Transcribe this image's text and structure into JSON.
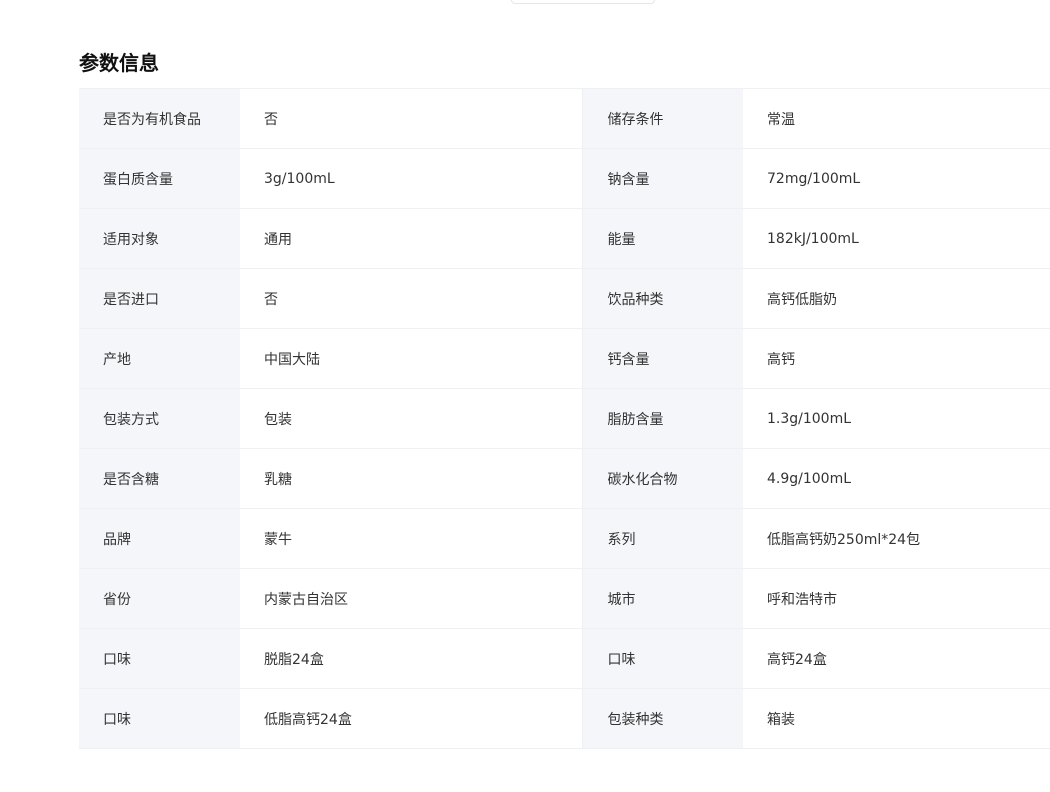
{
  "section": {
    "title": "参数信息"
  },
  "params": [
    {
      "left_label": "是否为有机食品",
      "left_value": "否",
      "right_label": "储存条件",
      "right_value": "常温"
    },
    {
      "left_label": "蛋白质含量",
      "left_value": "3g/100mL",
      "right_label": "钠含量",
      "right_value": "72mg/100mL"
    },
    {
      "left_label": "适用对象",
      "left_value": "通用",
      "right_label": "能量",
      "right_value": "182kJ/100mL"
    },
    {
      "left_label": "是否进口",
      "left_value": "否",
      "right_label": "饮品种类",
      "right_value": "高钙低脂奶"
    },
    {
      "left_label": "产地",
      "left_value": "中国大陆",
      "right_label": "钙含量",
      "right_value": "高钙"
    },
    {
      "left_label": "包装方式",
      "left_value": "包装",
      "right_label": "脂肪含量",
      "right_value": "1.3g/100mL"
    },
    {
      "left_label": "是否含糖",
      "left_value": "乳糖",
      "right_label": "碳水化合物",
      "right_value": "4.9g/100mL"
    },
    {
      "left_label": "品牌",
      "left_value": "蒙牛",
      "right_label": "系列",
      "right_value": "低脂高钙奶250ml*24包"
    },
    {
      "left_label": "省份",
      "left_value": "内蒙古自治区",
      "right_label": "城市",
      "right_value": "呼和浩特市"
    },
    {
      "left_label": "口味",
      "left_value": "脱脂24盒",
      "right_label": "口味",
      "right_value": "高钙24盒"
    },
    {
      "left_label": "口味",
      "left_value": "低脂高钙24盒",
      "right_label": "包装种类",
      "right_value": "箱装"
    }
  ]
}
